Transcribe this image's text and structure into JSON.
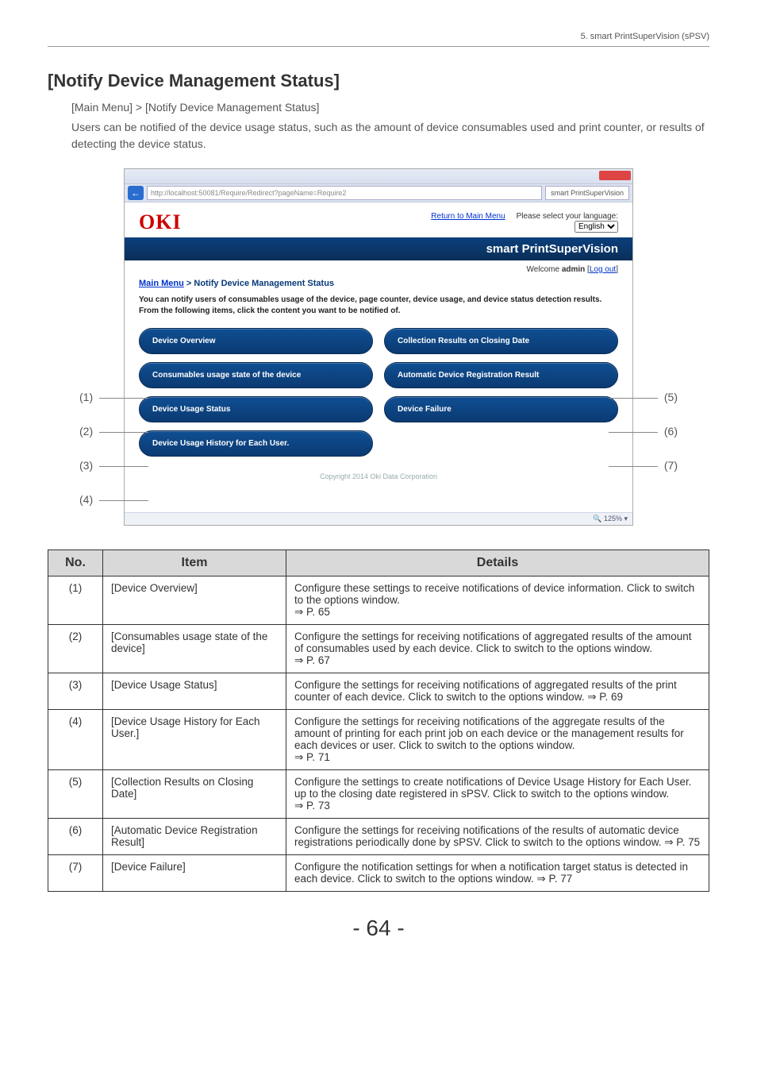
{
  "header": {
    "chapter": "5. smart PrintSuperVision (sPSV)"
  },
  "title": "[Notify Device Management Status]",
  "breadcrumb_text": "[Main Menu] > [Notify Device Management Status]",
  "intro_para": "Users can be notified of the device usage status, such as the amount of device consumables used and print counter, or results of detecting the device status.",
  "screenshot": {
    "url_text": "http://localhost:50081/Require/Redirect?pageName=Require2",
    "tab_label": "smart PrintSuperVision",
    "logo": "OKI",
    "return_link": "Return to Main Menu",
    "lang_label": "Please select your language:",
    "lang_value": "English",
    "banner": "smart PrintSuperVision",
    "welcome_prefix": "Welcome ",
    "welcome_user": "admin",
    "logout": "Log out",
    "crumb_main": "Main Menu",
    "crumb_sep": " > Notify Device Management Status",
    "notice_line1": "You can notify users of consumables usage of the device, page counter, device usage, and device status detection results.",
    "notice_line2": "From the following items, click the content you want to be notified of.",
    "buttons": {
      "b1": "Device Overview",
      "b2": "Consumables usage state of the device",
      "b3": "Device Usage Status",
      "b4": "Device Usage History for Each User.",
      "b5": "Collection Results on Closing Date",
      "b6": "Automatic Device Registration Result",
      "b7": "Device Failure"
    },
    "copyright": "Copyright 2014 Oki Data Corporation",
    "zoom": "125%"
  },
  "callouts": {
    "l1": "(1)",
    "l2": "(2)",
    "l3": "(3)",
    "l4": "(4)",
    "r5": "(5)",
    "r6": "(6)",
    "r7": "(7)"
  },
  "table": {
    "head_no": "No.",
    "head_item": "Item",
    "head_details": "Details",
    "rows": [
      {
        "no": "(1)",
        "item": "[Device Overview]",
        "details": "Configure these settings to receive notifications of device information. Click to switch to the options window.\n⇒ P. 65"
      },
      {
        "no": "(2)",
        "item": "[Consumables usage state of the device]",
        "details": "Configure the settings for receiving notifications of aggregated results of the amount of consumables used by each device. Click to switch to the options window.\n⇒ P. 67"
      },
      {
        "no": "(3)",
        "item": "[Device Usage Status]",
        "details": "Configure the settings for receiving notifications of aggregated results of the print counter of each device. Click to switch to the options window. ⇒ P. 69"
      },
      {
        "no": "(4)",
        "item": "[Device Usage History for Each User.]",
        "details": "Configure the settings for receiving notifications of the aggregate results of the amount of printing for each print job on each device or the management results for each devices or user. Click to switch to the options window.\n⇒ P. 71"
      },
      {
        "no": "(5)",
        "item": "[Collection Results on Closing Date]",
        "details": "Configure the settings to create notifications of Device Usage History for Each User. up to the closing date registered in sPSV. Click to switch to the options window.\n⇒ P. 73"
      },
      {
        "no": "(6)",
        "item": "[Automatic Device Registration Result]",
        "details": "Configure the settings for receiving notifications of the results of automatic device registrations periodically done by sPSV. Click to switch to the options window. ⇒ P. 75"
      },
      {
        "no": "(7)",
        "item": "[Device Failure]",
        "details": "Configure the notification settings for when a notification target status is detected in each device. Click to switch to the options window. ⇒ P. 77"
      }
    ]
  },
  "page_number": "- 64 -"
}
